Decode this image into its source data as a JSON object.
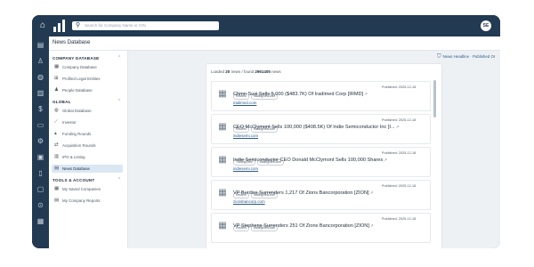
{
  "header": {
    "search_placeholder": "Search for Company Name or CIN",
    "avatar_initials": "SE"
  },
  "page_title": "News Database",
  "sidebar": {
    "company_section": "COMPANY DATABASE",
    "company_items": [
      {
        "label": "Company Database",
        "icon": "building-icon"
      },
      {
        "label": "Profiled Legal Entities",
        "icon": "entities-icon"
      },
      {
        "label": "People Database",
        "icon": "people-icon"
      }
    ],
    "global_section": "GLOBAL",
    "global_items": [
      {
        "label": "Global Database",
        "icon": "globe-icon"
      },
      {
        "label": "Investor",
        "icon": "investor-icon"
      },
      {
        "label": "Funding Rounds",
        "icon": "funding-icon"
      },
      {
        "label": "Acquisition Rounds",
        "icon": "acquisition-icon"
      },
      {
        "label": "IPO & Listing",
        "icon": "ipo-icon"
      },
      {
        "label": "News Database",
        "icon": "news-icon"
      }
    ],
    "tools_section": "TOOLS & ACCOUNT",
    "tools_items": [
      {
        "label": "My Saved Companies",
        "icon": "saved-icon"
      },
      {
        "label": "My Company Reports",
        "icon": "reports-icon"
      }
    ]
  },
  "filter_label": "News Headline · Published Or",
  "results": {
    "prefix": "Loaded",
    "loaded": "20",
    "middle": "news / found",
    "found": "2961405",
    "suffix": "news"
  },
  "news": [
    {
      "tags": [
        "Reuters",
        "tradingview.com"
      ],
      "published": "Published: 2025-12-18",
      "headline": "Chmn Susi Sells 5,000 ($483.7K) Of Iradimed Corp [IRMD]",
      "source": "iradimed.com"
    },
    {
      "tags": [
        "Reuters",
        "tradingview.com"
      ],
      "published": "Published: 2025-12-18",
      "headline": "CEO McClymont Sells 100,000 ($408.5K) Of Indie Semiconductor Inc [I...",
      "source": "indiesemi.com"
    },
    {
      "tags": [
        "TradingView",
        "tradingview.com"
      ],
      "published": "Published: 2025-12-18",
      "headline": "Indie Semiconductor CEO Donald McClymont Sells 100,000 Shares",
      "source": "indiesemi.com"
    },
    {
      "tags": [
        "Reuters",
        "tradingview.com"
      ],
      "published": "Published: 2025-12-18",
      "headline": "VP Burdiss Surrenders 1,217 Of Zions Bancorporation [ZION]",
      "source": "zionsbancorp.com"
    },
    {
      "tags": [
        "Reuters",
        "tradingview.com"
      ],
      "published": "Published: 2025-12-18",
      "headline": "VP Stephens Surrenders 251 Of Zions Bancorporation [ZION]",
      "source": ""
    }
  ],
  "colors": {
    "nav_bg": "#223a52",
    "active_bg": "#dbe7f3",
    "link": "#2a5a8a"
  }
}
